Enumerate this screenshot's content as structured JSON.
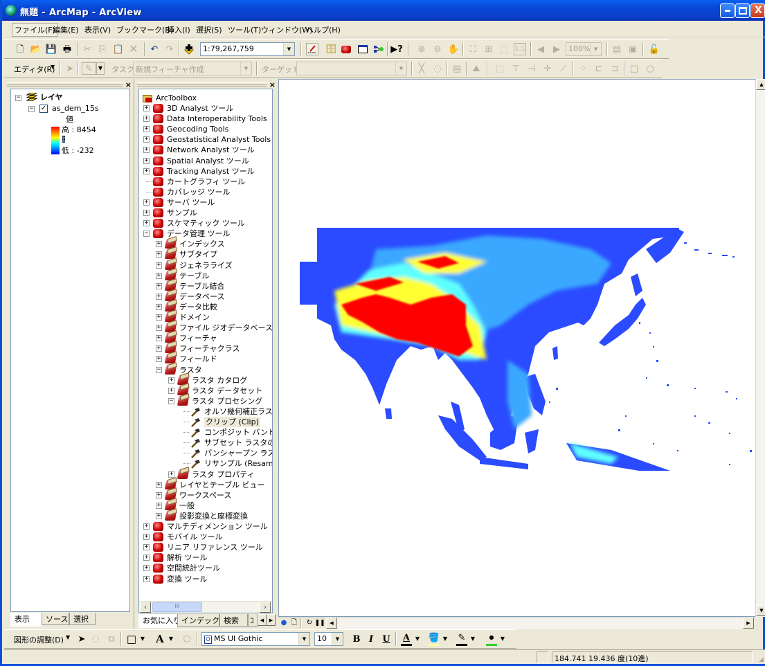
{
  "window": {
    "title": "無題 - ArcMap - ArcView",
    "controls": {
      "minimize": "_",
      "maximize": "□",
      "close": "X"
    }
  },
  "menubar": [
    {
      "label": "ファイル(F)",
      "active": true
    },
    {
      "label": "編集(E)"
    },
    {
      "label": "表示(V)"
    },
    {
      "label": "ブックマーク(B)"
    },
    {
      "label": "挿入(I)"
    },
    {
      "label": "選択(S)"
    },
    {
      "label": "ツール(T)"
    },
    {
      "label": "ウィンドウ(W)"
    },
    {
      "label": "ヘルプ(H)"
    }
  ],
  "standard_toolbar": {
    "icons": [
      "new-document-icon",
      "open-folder-icon",
      "save-icon",
      "print-icon",
      "cut-icon",
      "copy-icon",
      "paste-icon",
      "delete-icon",
      "undo-icon",
      "redo-icon",
      "add-data-icon"
    ],
    "scale_value": "1:79,267,759",
    "tools_icons": [
      "editor-toolbar-icon",
      "arccatalog-icon",
      "arctoolbox-icon",
      "command-line-icon",
      "model-builder-icon",
      "whats-this-icon"
    ],
    "layout_icons": [
      "zoom-in-layout-icon",
      "zoom-out-layout-icon",
      "pan-layout-icon",
      "zoom-whole-page-icon",
      "zoom-to-100-icon",
      "fixed-zoom-in-icon",
      "fixed-zoom-out-icon",
      "go-back-extent-icon",
      "go-forward-extent-icon"
    ],
    "zoom_percent": "100%",
    "extra_icons": [
      "toggle-draft-mode-icon",
      "focus-data-frame-icon",
      "change-layout-icon"
    ]
  },
  "editor_toolbar": {
    "editor_label": "エディタ(R)",
    "task_label": "タスク:",
    "task_value": "新規フィーチャ作成",
    "target_label": "ターゲット:",
    "target_value": ""
  },
  "toc_panel": {
    "root_label": "レイヤ",
    "layer_name": "as_dem_15s",
    "layer_checked": true,
    "legend_title": "値",
    "legend_high": "高 : 8454",
    "legend_low": "低 : -232",
    "ramp_colors": [
      "#ff0000",
      "#ff8000",
      "#ffff00",
      "#00ffff",
      "#0080ff",
      "#0000ff"
    ],
    "tabs": [
      "表示",
      "ソース",
      "選択"
    ],
    "selected_tab": "表示"
  },
  "toolbox_panel": {
    "root": "ArcToolbox",
    "items": [
      {
        "label": "3D Analyst ツール",
        "level": 0,
        "expand": "+",
        "icon": "red"
      },
      {
        "label": "Data Interoperability Tools",
        "level": 0,
        "expand": "+",
        "icon": "red"
      },
      {
        "label": "Geocoding Tools",
        "level": 0,
        "expand": "+",
        "icon": "red"
      },
      {
        "label": "Geostatistical Analyst Tools",
        "level": 0,
        "expand": "+",
        "icon": "red"
      },
      {
        "label": "Network Analyst ツール",
        "level": 0,
        "expand": "+",
        "icon": "red"
      },
      {
        "label": "Spatial Analyst ツール",
        "level": 0,
        "expand": "+",
        "icon": "red"
      },
      {
        "label": "Tracking Analyst ツール",
        "level": 0,
        "expand": "+",
        "icon": "red"
      },
      {
        "label": "カートグラフィ ツール",
        "level": 0,
        "expand": "",
        "icon": "red"
      },
      {
        "label": "カバレッジ ツール",
        "level": 0,
        "expand": "",
        "icon": "red"
      },
      {
        "label": "サーバ ツール",
        "level": 0,
        "expand": "+",
        "icon": "red"
      },
      {
        "label": "サンプル",
        "level": 0,
        "expand": "+",
        "icon": "red"
      },
      {
        "label": "スケマティック ツール",
        "level": 0,
        "expand": "+",
        "icon": "red"
      },
      {
        "label": "データ管理 ツール",
        "level": 0,
        "expand": "-",
        "icon": "red"
      },
      {
        "label": "インデックス",
        "level": 1,
        "expand": "+",
        "icon": "open"
      },
      {
        "label": "サブタイプ",
        "level": 1,
        "expand": "+",
        "icon": "open"
      },
      {
        "label": "ジェネラライズ",
        "level": 1,
        "expand": "+",
        "icon": "open"
      },
      {
        "label": "テーブル",
        "level": 1,
        "expand": "+",
        "icon": "open"
      },
      {
        "label": "テーブル結合",
        "level": 1,
        "expand": "+",
        "icon": "open"
      },
      {
        "label": "データベース",
        "level": 1,
        "expand": "+",
        "icon": "open"
      },
      {
        "label": "データ比較",
        "level": 1,
        "expand": "+",
        "icon": "open"
      },
      {
        "label": "ドメイン",
        "level": 1,
        "expand": "+",
        "icon": "open"
      },
      {
        "label": "ファイル ジオデータベース",
        "level": 1,
        "expand": "+",
        "icon": "open"
      },
      {
        "label": "フィーチャ",
        "level": 1,
        "expand": "+",
        "icon": "open"
      },
      {
        "label": "フィーチャクラス",
        "level": 1,
        "expand": "+",
        "icon": "open"
      },
      {
        "label": "フィールド",
        "level": 1,
        "expand": "+",
        "icon": "open"
      },
      {
        "label": "ラスタ",
        "level": 1,
        "expand": "-",
        "icon": "open"
      },
      {
        "label": "ラスタ カタログ",
        "level": 2,
        "expand": "+",
        "icon": "open"
      },
      {
        "label": "ラスタ データセット",
        "level": 2,
        "expand": "+",
        "icon": "open"
      },
      {
        "label": "ラスタ プロセシング",
        "level": 2,
        "expand": "-",
        "icon": "open"
      },
      {
        "label": "オルソ幾何補正ラスタ",
        "level": 3,
        "expand": "",
        "icon": "hammer"
      },
      {
        "label": "クリップ (Clip)",
        "level": 3,
        "expand": "",
        "icon": "hammer",
        "selected": true
      },
      {
        "label": "コンポジット バンド (C",
        "level": 3,
        "expand": "",
        "icon": "hammer"
      },
      {
        "label": "サブセット ラスタの抽出",
        "level": 3,
        "expand": "",
        "icon": "hammer"
      },
      {
        "label": "パンシャープン ラスタ ミ",
        "level": 3,
        "expand": "",
        "icon": "hammer"
      },
      {
        "label": "リサンプル (Resample",
        "level": 3,
        "expand": "",
        "icon": "hammer"
      },
      {
        "label": "ラスタ プロパティ",
        "level": 2,
        "expand": "+",
        "icon": "open"
      },
      {
        "label": "レイヤとテーブル ビュー",
        "level": 1,
        "expand": "+",
        "icon": "open"
      },
      {
        "label": "ワークスペース",
        "level": 1,
        "expand": "+",
        "icon": "open"
      },
      {
        "label": "一般",
        "level": 1,
        "expand": "+",
        "icon": "open"
      },
      {
        "label": "投影変換と座標変換",
        "level": 1,
        "expand": "+",
        "icon": "open"
      },
      {
        "label": "マルチディメンション ツール",
        "level": 0,
        "expand": "+",
        "icon": "red"
      },
      {
        "label": "モバイル ツール",
        "level": 0,
        "expand": "+",
        "icon": "red"
      },
      {
        "label": "リニア リファレンス ツール",
        "level": 0,
        "expand": "+",
        "icon": "red"
      },
      {
        "label": "解析 ツール",
        "level": 0,
        "expand": "+",
        "icon": "red"
      },
      {
        "label": "空間統計ツール",
        "level": 0,
        "expand": "+",
        "icon": "red"
      },
      {
        "label": "変換 ツール",
        "level": 0,
        "expand": "+",
        "icon": "red"
      }
    ],
    "tabs": [
      "お気に入り",
      "インデックス",
      "検索",
      "ｺ"
    ],
    "selected_tab": "お気に入り",
    "hscroll_thumb": "III"
  },
  "map": {
    "layer": "as_dem_15s",
    "colors": {
      "low": "#2a4bff",
      "mid_low": "#3aa8ff",
      "mid": "#5fffff",
      "mid_high": "#ffff33",
      "high": "#ff0000"
    }
  },
  "view_buttons": [
    "data-view-icon",
    "layout-view-icon",
    "refresh-icon",
    "pause-drawing-icon"
  ],
  "draw_toolbar": {
    "drawing_label": "図形の調整(D)",
    "font_name": "MS UI Gothic",
    "font_size": "10",
    "bold": "B",
    "italic": "I",
    "underline": "U",
    "font_color": "#000000",
    "fill_color": "#ffff99",
    "line_color": "#000000",
    "marker_color": "#33cc33"
  },
  "statusbar": {
    "coordinates": "184.741  19.436 度(10進)"
  }
}
